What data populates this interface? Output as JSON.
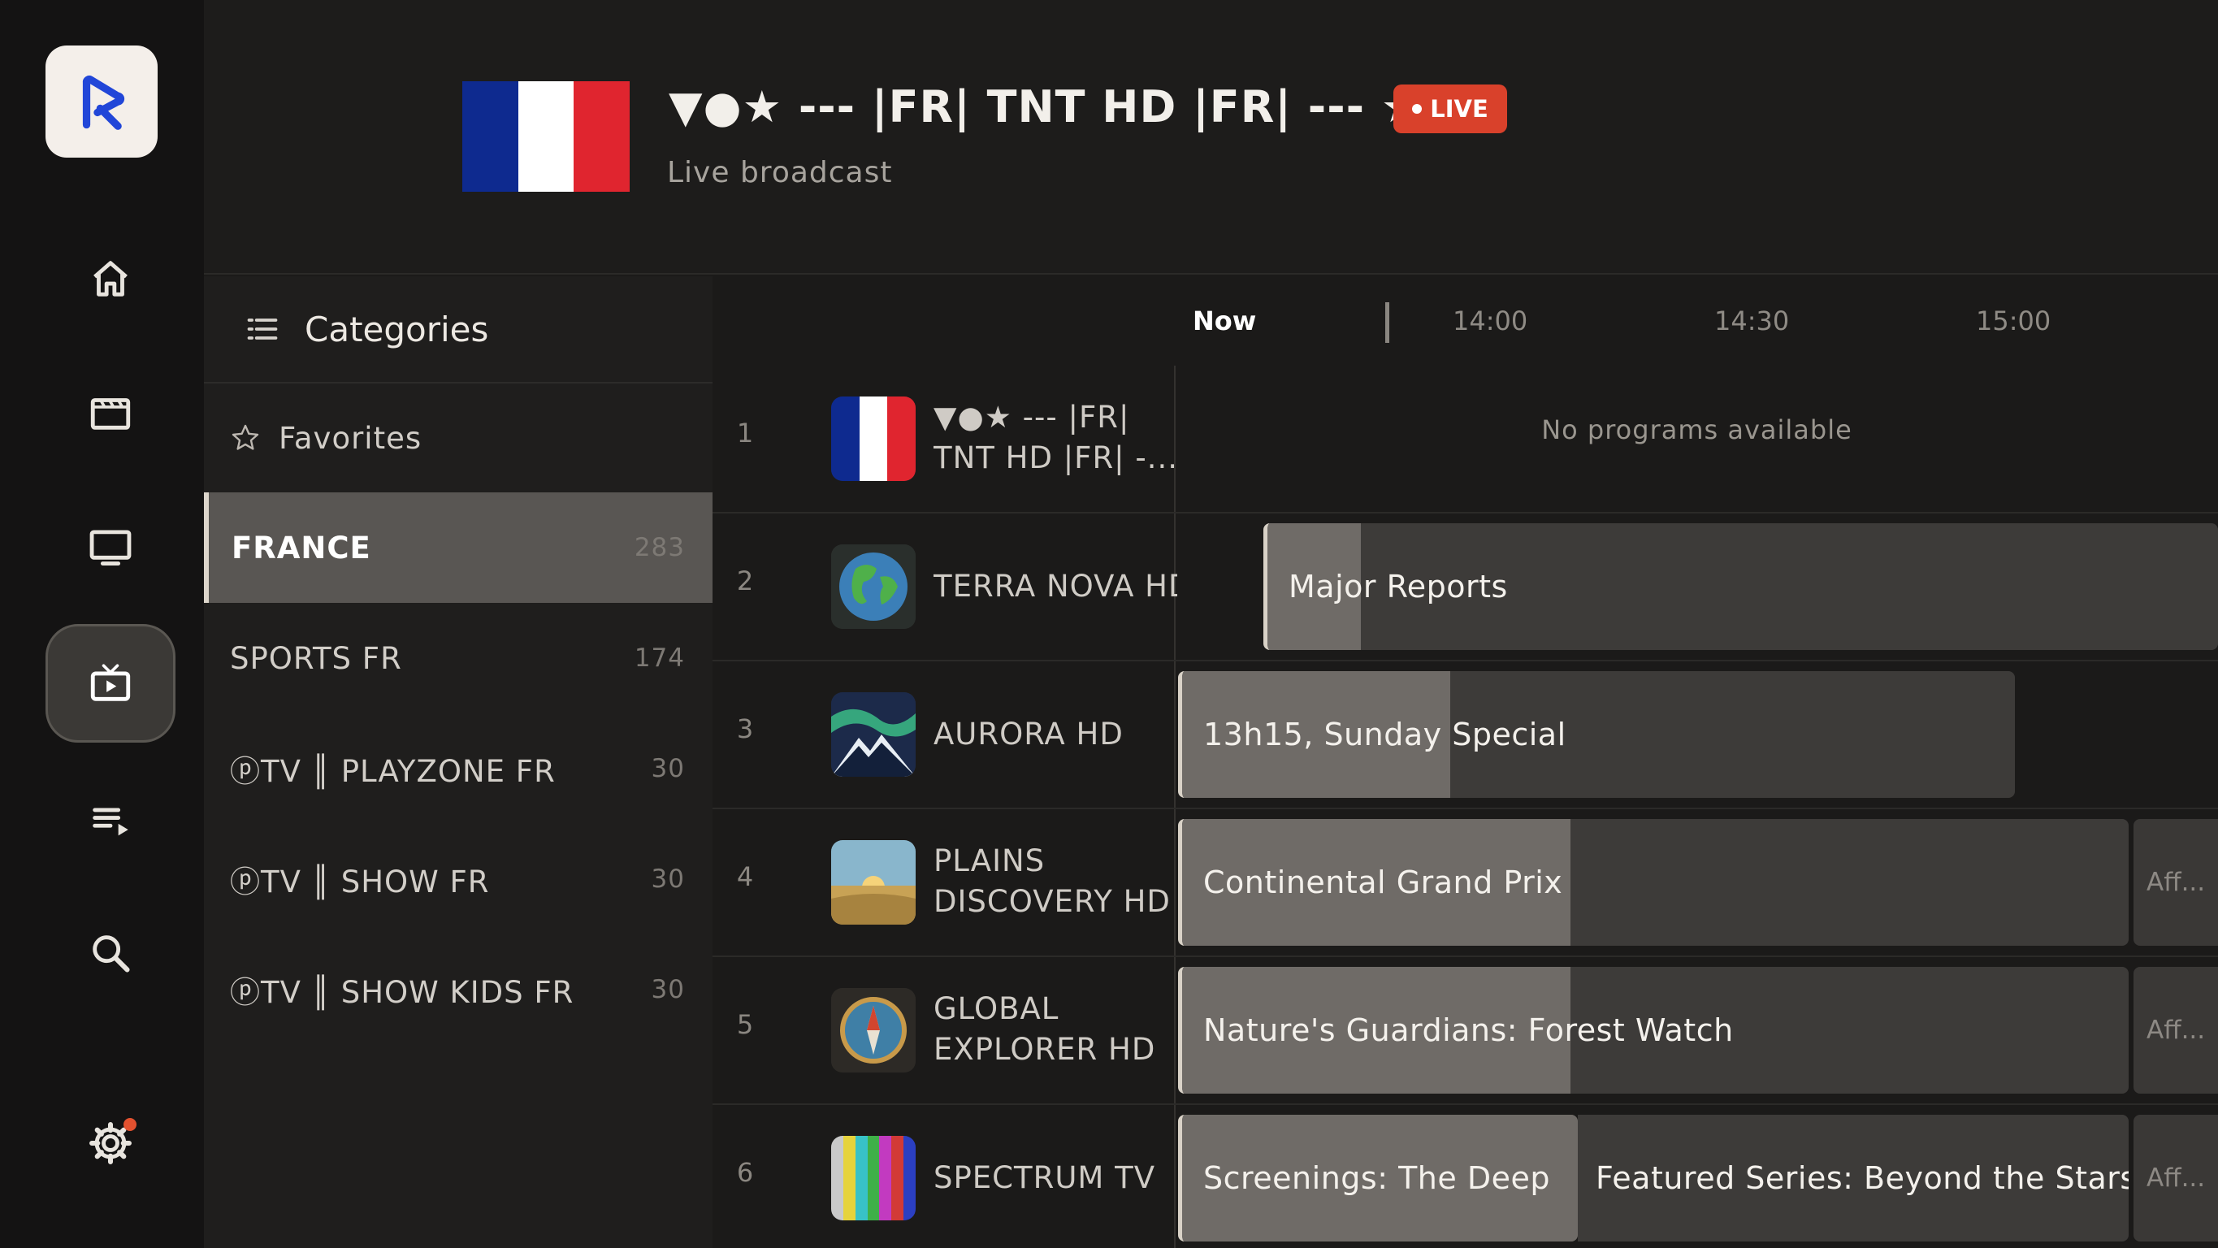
{
  "rail": {
    "items": [
      "home",
      "movies",
      "tv",
      "live",
      "playlist",
      "search",
      "settings"
    ],
    "active": "live"
  },
  "header": {
    "title": "▼●★ --- |FR| TNT HD |FR| --- ★●▼",
    "live_badge": "LIVE",
    "subtitle": "Live broadcast"
  },
  "categories": {
    "title": "Categories",
    "favorites": "Favorites",
    "items": [
      {
        "name": "FRANCE",
        "count": "283",
        "active": true
      },
      {
        "name": "SPORTS FR",
        "count": "174"
      },
      {
        "name": "ⓟTV ║ PLAYZONE FR",
        "count": "30"
      },
      {
        "name": "ⓟTV ║ SHOW FR",
        "count": "30"
      },
      {
        "name": "ⓟTV ║ SHOW KIDS FR",
        "count": "30"
      }
    ]
  },
  "guide": {
    "times": {
      "now": "Now",
      "t1": "14:00",
      "t2": "14:30",
      "t3": "15:00"
    },
    "channels": [
      {
        "num": "1",
        "name_l1": "▼●★ --- |FR|",
        "name_l2": "TNT HD |FR| -...",
        "empty": "No programs available"
      },
      {
        "num": "2",
        "name": "TERRA NOVA HD",
        "programs": [
          "Major Reports"
        ]
      },
      {
        "num": "3",
        "name": "AURORA HD",
        "programs": [
          "13h15, Sunday Special"
        ]
      },
      {
        "num": "4",
        "name_l1": "PLAINS",
        "name_l2": "DISCOVERY HD",
        "programs": [
          "Continental Grand Prix"
        ],
        "next": "Aff..."
      },
      {
        "num": "5",
        "name_l1": "GLOBAL",
        "name_l2": "EXPLORER HD",
        "programs": [
          "Nature's Guardians: Forest Watch"
        ],
        "next": "Aff..."
      },
      {
        "num": "6",
        "name": "SPECTRUM TV",
        "programs": [
          "Screenings: The Deep",
          "Featured Series: Beyond the Stars"
        ],
        "next": "Aff..."
      }
    ]
  },
  "colors": {
    "live": "#d9412b",
    "flag_blue": "#0e2a8f",
    "flag_white": "#ffffff",
    "flag_red": "#e0252f"
  }
}
